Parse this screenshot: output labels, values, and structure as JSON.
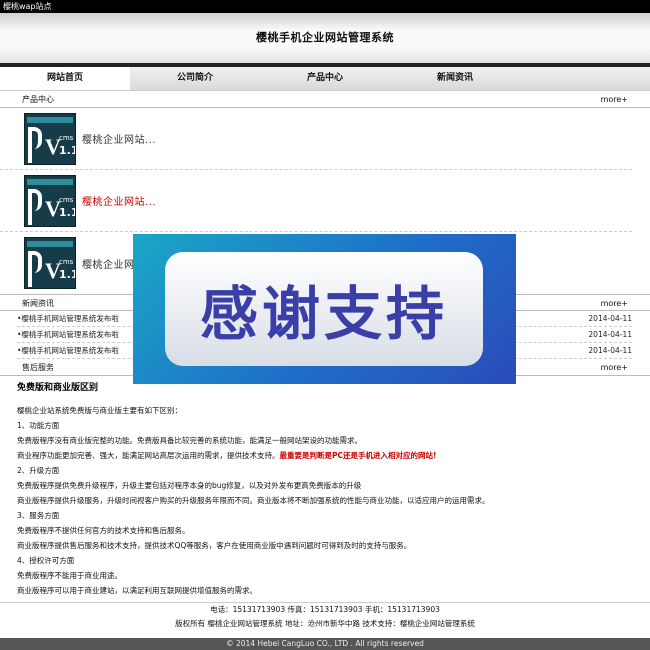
{
  "site": {
    "tab_title": "樱桃wap站点",
    "header_title": "樱桃手机企业网站管理系统"
  },
  "nav": [
    {
      "label": "网站首页",
      "active": true
    },
    {
      "label": "公司简介",
      "active": false
    },
    {
      "label": "产品中心",
      "active": false
    },
    {
      "label": "新闻资讯",
      "active": false
    }
  ],
  "products": {
    "section_title": "产品中心",
    "more": "more+",
    "items": [
      {
        "title": "樱桃企业网站...",
        "highlight": false,
        "thumb": {
          "brand": "樱桃企业商业版",
          "letter_v": "V",
          "cms": "cms",
          "version": "1.1"
        }
      },
      {
        "title": "樱桃企业网站...",
        "highlight": true,
        "thumb": {
          "brand": "樱桃企业商业版",
          "letter_v": "V",
          "cms": "cms",
          "version": "1.1"
        }
      },
      {
        "title": "樱桃企业网",
        "highlight": false,
        "thumb": {
          "brand": "樱桃企业商业版",
          "letter_v": "V",
          "cms": "cms",
          "version": "1.1"
        }
      }
    ]
  },
  "news": {
    "section_title": "新闻资讯",
    "more": "more+",
    "items": [
      {
        "title": "•樱桃手机网站管理系统发布啦",
        "date": "2014-04-11"
      },
      {
        "title": "•樱桃手机网站管理系统发布啦",
        "date": "2014-04-11"
      },
      {
        "title": "•樱桃手机网站管理系统发布啦",
        "date": "2014-04-11"
      }
    ]
  },
  "service": {
    "section_title": "售后服务",
    "more": "more+"
  },
  "article": {
    "heading": "免费版和商业版区别",
    "lines": [
      {
        "text": "樱桃企业站系统免费版与商业版主要有如下区别："
      },
      {
        "text": "1、功能方面"
      },
      {
        "text": "免费版程序没有商业版完整的功能。免费版具备比较完善的系统功能，能满足一般网站架设的功能需求。"
      },
      {
        "text": "商业程序功能更加完善、强大，能满足网站高层次运用的需求，提供技术支持。",
        "warn": "最重要是判断是PC还是手机进入相对应的网站!"
      },
      {
        "text": "2、升级方面"
      },
      {
        "text": "免费版程序提供免费升级程序，升级主要包括对程序本身的bug修复，以及对外发布更高免费版本的升级"
      },
      {
        "text": "商业版程序提供升级服务，升级时间视客户购买的升级服务年限而不同。商业版本将不断加强系统的性能与商业功能，以适应用户的运用需求。"
      },
      {
        "text": "3、服务方面"
      },
      {
        "text": "免费版程序不提供任何官方的技术支持和售后服务。"
      },
      {
        "text": "商业版程序提供售后服务和技术支持，提供技术QQ等服务，客户在使用商业版中遇到问题时可得到及时的支持与服务。"
      },
      {
        "text": "4、授权许可方面"
      },
      {
        "text": "免费版程序不能用于商业用途。"
      },
      {
        "text": "商业版程序可以用于商业建站，以满足利用互联网提供增值服务的需求。"
      }
    ]
  },
  "footer": {
    "contact": "电话：15131713903  传真：15131713903  手机：15131713903",
    "rights": "版权所有  樱桃企业网站管理系统  地址：沧州市新华中路  技术支持：樱桃企业网站管理系统",
    "copyright": "© 2014 Hebei CangLuo CO., LTD . All rights reserved"
  },
  "overlay": {
    "text": "感谢支持"
  }
}
